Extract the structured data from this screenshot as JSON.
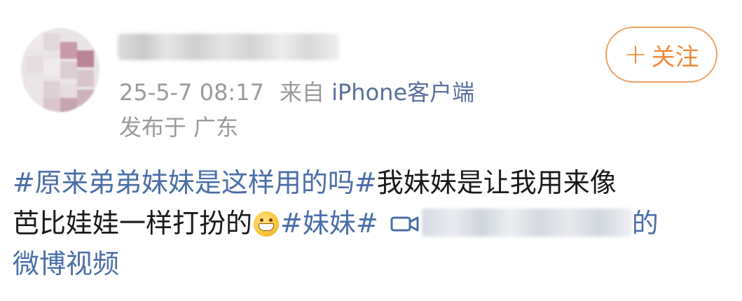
{
  "post": {
    "meta": {
      "time": "25-5-7 08:17",
      "from": "来自",
      "device": "iPhone客户端",
      "location": "发布于 广东"
    },
    "follow_button": {
      "plus": "+",
      "label": "关注"
    },
    "body": {
      "line1_hashtag": "#原来弟弟妹妹是这样用的吗#",
      "line1_text": "我妹妹是让我用来像",
      "line2_text": "芭比娃娃一样打扮的",
      "line2_hashtag": "#妹妹#",
      "video_link_suffix": "的",
      "line3_text": "微博视频"
    },
    "icons": {
      "emoji": "grinning-emoji-icon",
      "video": "video-camera-icon"
    },
    "colors": {
      "link": "#4a6ea8",
      "follow": "#f08a3a",
      "meta": "#9b9b9b",
      "device": "#5a6f9c"
    }
  }
}
